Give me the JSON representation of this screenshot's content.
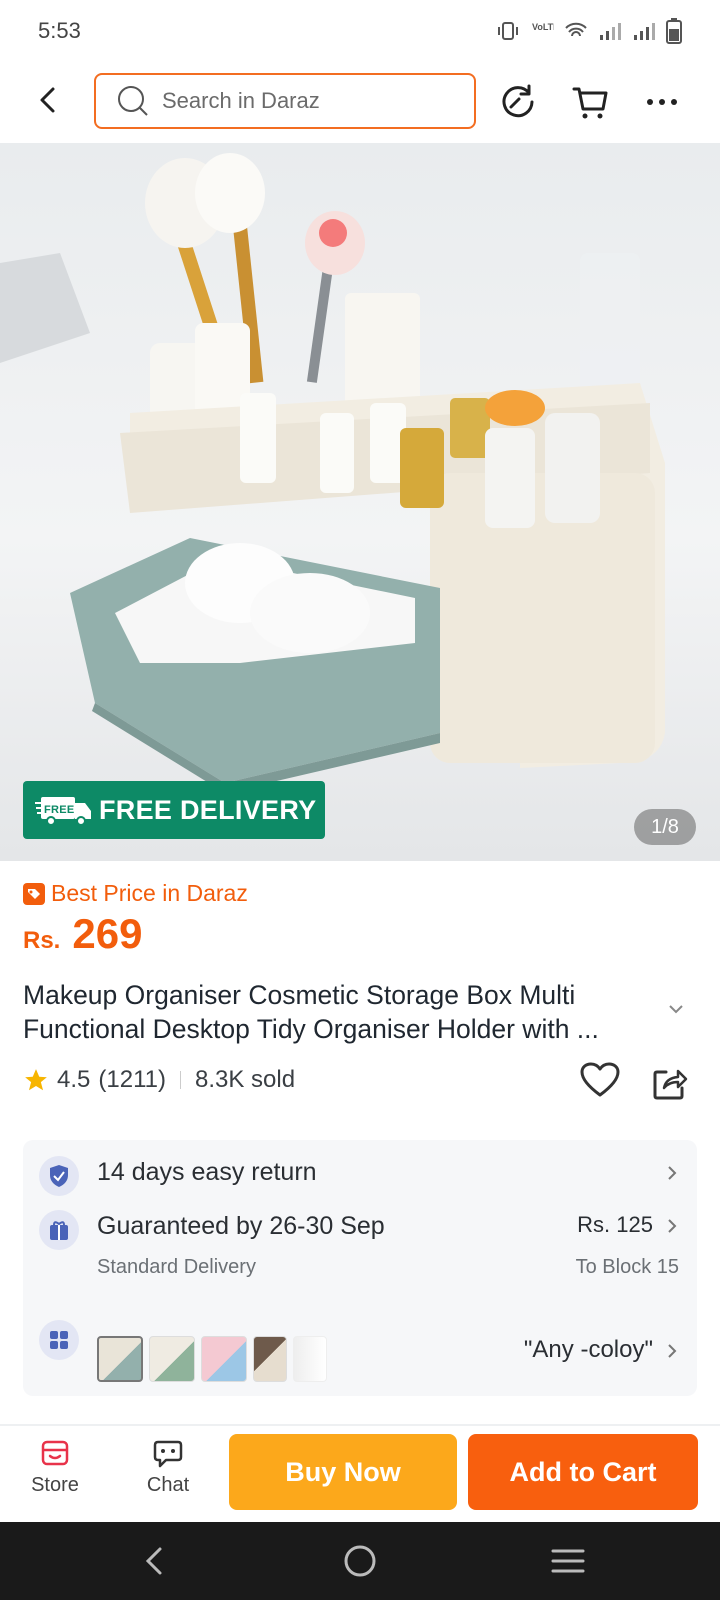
{
  "status_bar": {
    "time": "5:53"
  },
  "header": {
    "search_placeholder": "Search in Daraz"
  },
  "hero": {
    "badge_text": "FREE DELIVERY",
    "badge_truck_text": "FREE",
    "page_indicator": "1/8"
  },
  "product": {
    "best_price_label": "Best Price in Daraz",
    "currency": "Rs.",
    "price": "269",
    "title": "Makeup Organiser Cosmetic Storage Box Multi Functional Desktop Tidy Organiser Holder with ...",
    "rating": "4.5",
    "rating_count": "(1211)",
    "sold": "8.3K sold"
  },
  "services": {
    "return_text": "14 days easy return",
    "delivery_text": "Guaranteed by 26-30 Sep",
    "delivery_type": "Standard Delivery",
    "delivery_price": "Rs. 125",
    "delivery_location": "To Block 15",
    "variant_text": "\"Any -coloy\""
  },
  "bottom_bar": {
    "store_label": "Store",
    "chat_label": "Chat",
    "buy_now_label": "Buy Now",
    "add_to_cart_label": "Add to Cart"
  },
  "colors": {
    "accent": "#f85f0e",
    "buy_now": "#fca81b",
    "free_badge": "#0d8a66"
  }
}
